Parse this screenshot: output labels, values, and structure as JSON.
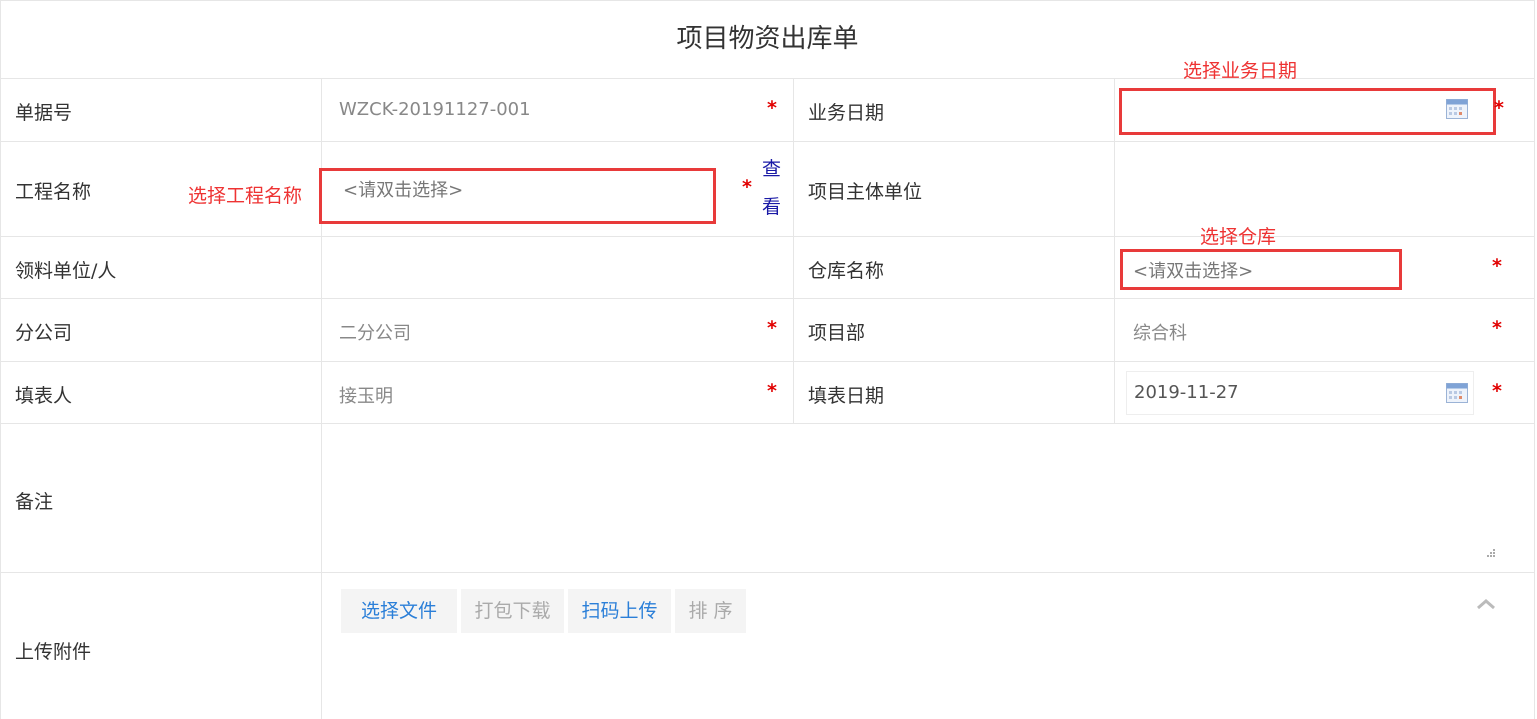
{
  "title": "项目物资出库单",
  "fields": {
    "doc_no": {
      "label": "单据号",
      "value": "WZCK-20191127-001"
    },
    "biz_date": {
      "label": "业务日期",
      "value": ""
    },
    "project_name": {
      "label": "工程名称",
      "placeholder": "<请双击选择>",
      "view_link": "查看"
    },
    "project_unit": {
      "label": "项目主体单位",
      "value": ""
    },
    "receiver": {
      "label": "领料单位/人",
      "value": ""
    },
    "warehouse": {
      "label": "仓库名称",
      "placeholder": "<请双击选择>"
    },
    "branch": {
      "label": "分公司",
      "value": "二分公司"
    },
    "dept": {
      "label": "项目部",
      "value": "综合科"
    },
    "filler": {
      "label": "填表人",
      "value": "接玉明"
    },
    "fill_date": {
      "label": "填表日期",
      "value": "2019-11-27"
    },
    "remark": {
      "label": "备注",
      "value": ""
    },
    "attachment": {
      "label": "上传附件"
    }
  },
  "required_mark": "*",
  "annotations": {
    "select_date": "选择业务日期",
    "select_project": "选择工程名称",
    "select_warehouse": "选择仓库"
  },
  "buttons": {
    "select_file": "选择文件",
    "pack_download": "打包下载",
    "scan_upload": "扫码上传",
    "sort": "排 序"
  },
  "colors": {
    "required": "#e10000",
    "annotation": "#e33333",
    "link": "#1a1aa6",
    "button_active": "#2b7fd8"
  }
}
